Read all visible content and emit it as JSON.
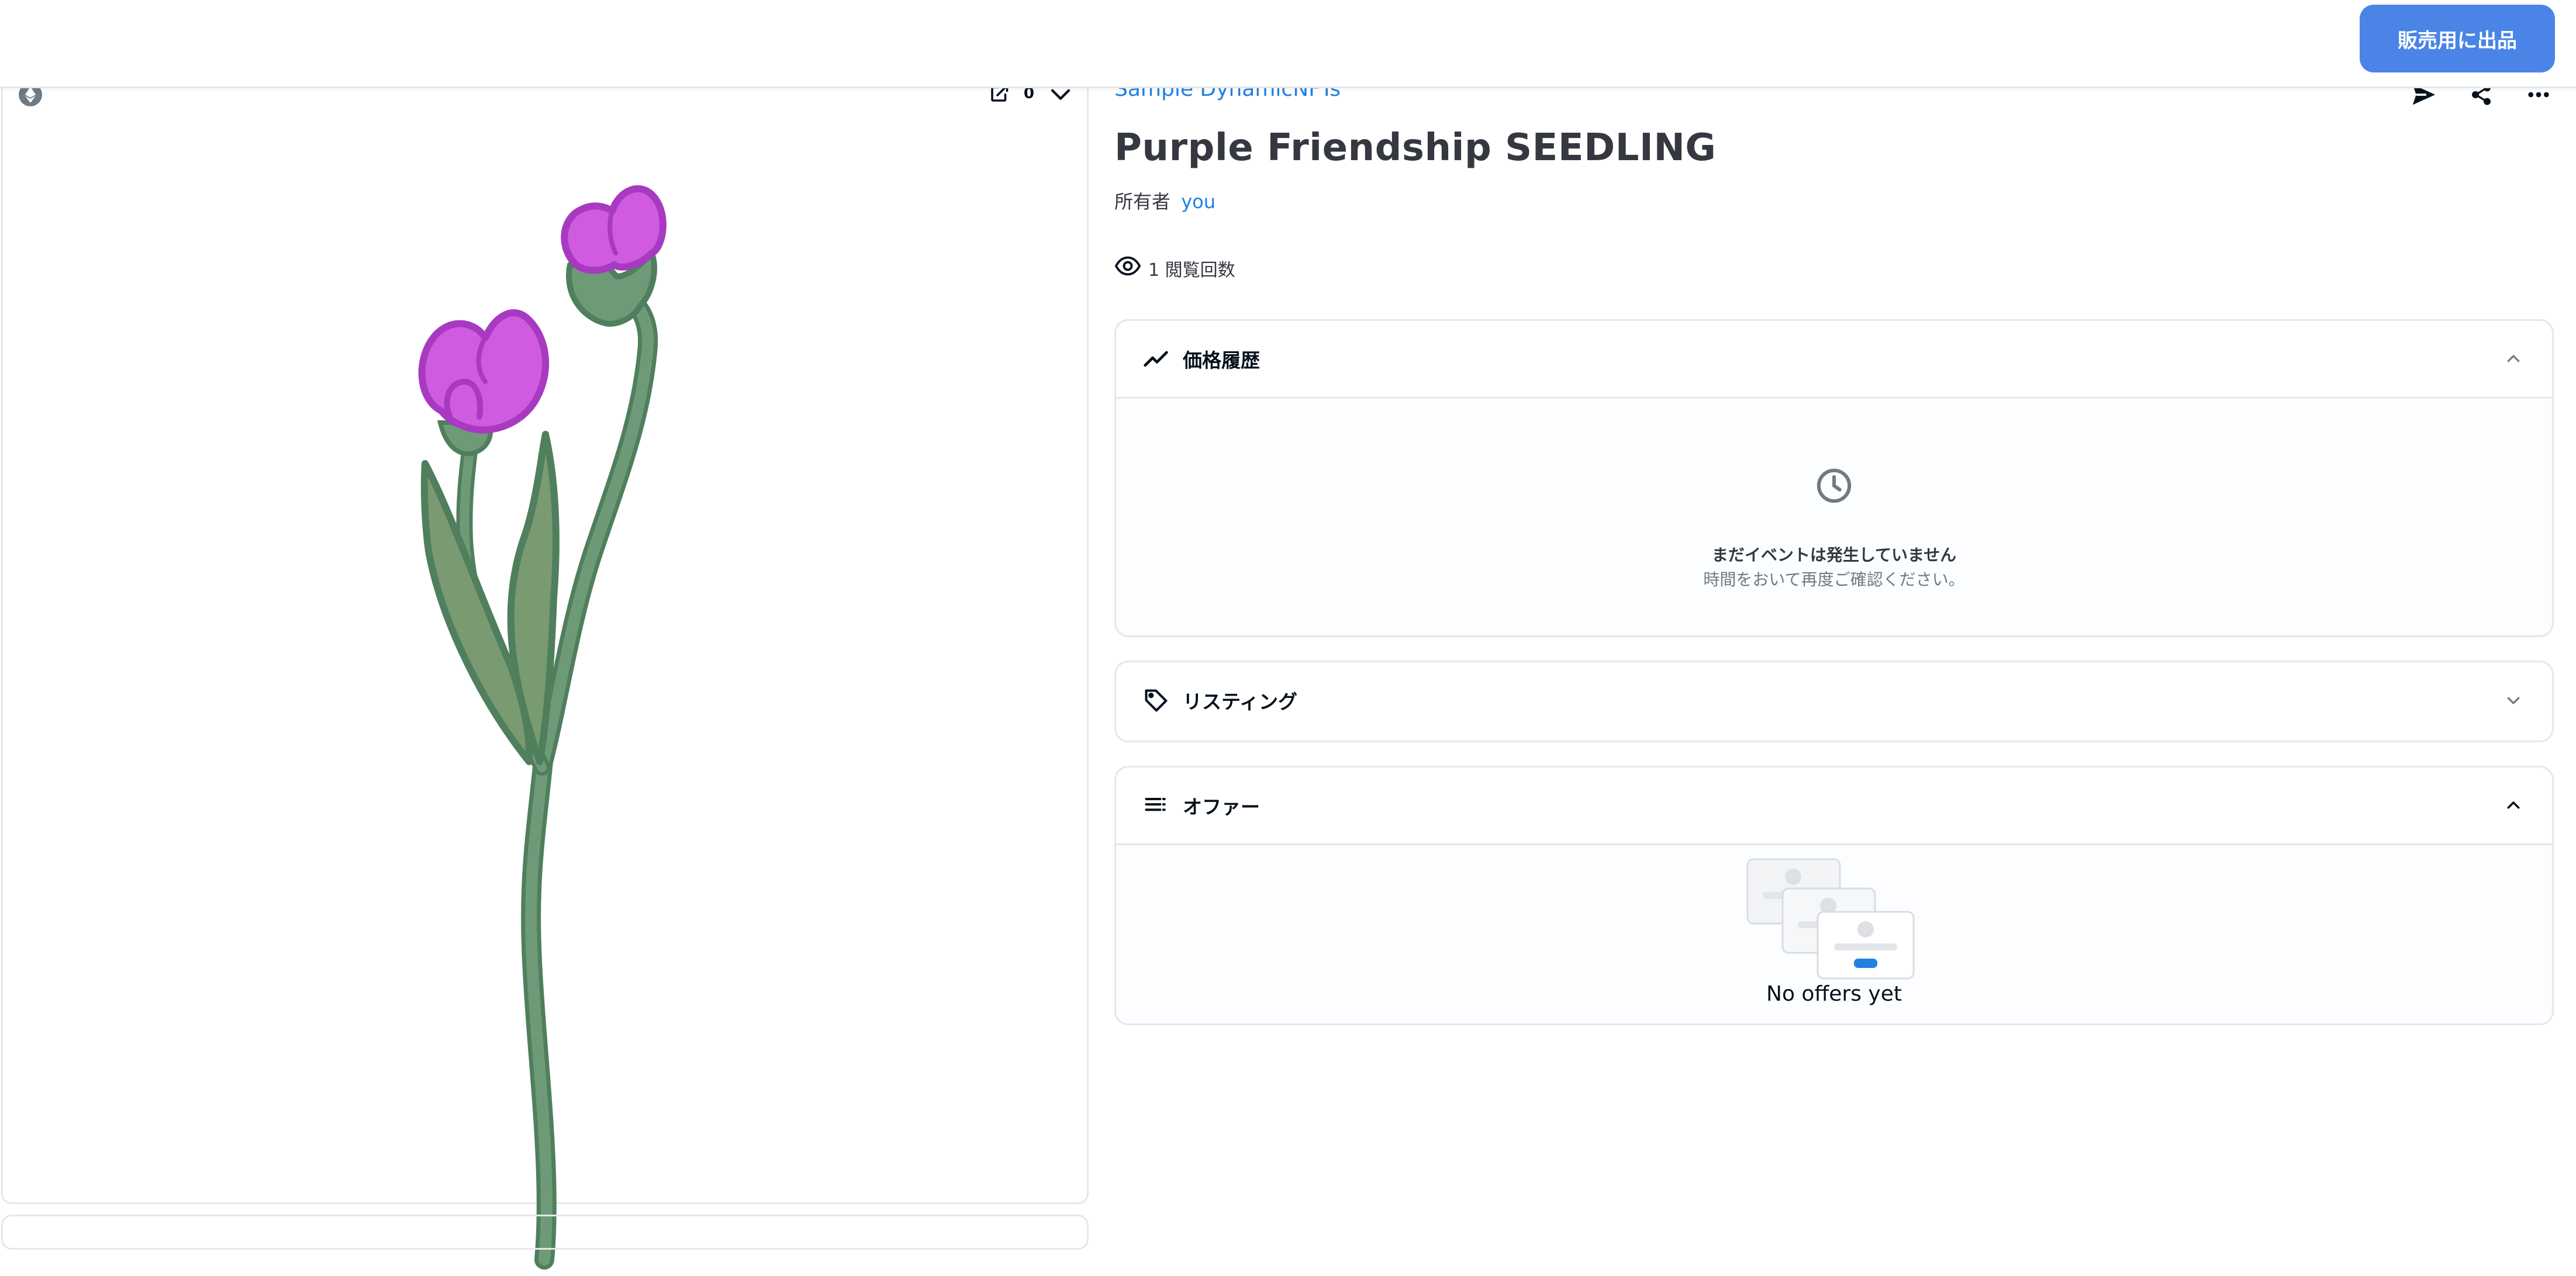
{
  "topbar": {
    "sell_button_label": "販売用に出品"
  },
  "media": {
    "like_count": "0"
  },
  "item": {
    "collection_name": "Sample DynamicNFTs",
    "title": "Purple Friendship SEEDLING",
    "owner_prefix": "所有者",
    "owner_name": "you",
    "views_text": "1 閲覧回数"
  },
  "panels": {
    "price_history": {
      "title": "価格履歴",
      "empty_title": "まだイベントは発生していません",
      "empty_subtitle": "時間をおいて再度ご確認ください。"
    },
    "listings": {
      "title": "リスティング"
    },
    "offers": {
      "title": "オファー",
      "empty_text": "No offers yet"
    }
  },
  "colors": {
    "accent": "#2081e2",
    "button": "#4a84e6",
    "petal": "#cf5ce0",
    "petal_outline": "#a73ac0",
    "stem": "#5e8c6a",
    "stem_fill": "#7a9a72"
  },
  "icons": {
    "chain": "ethereum-icon",
    "open_external": "open-external-icon",
    "favorite": "heart-icon",
    "transfer": "send-icon",
    "share": "share-icon",
    "more": "more-icon",
    "views": "eye-icon",
    "price_history": "trend-icon",
    "empty_state": "clock-icon",
    "listings": "tag-icon",
    "offers": "list-icon"
  }
}
